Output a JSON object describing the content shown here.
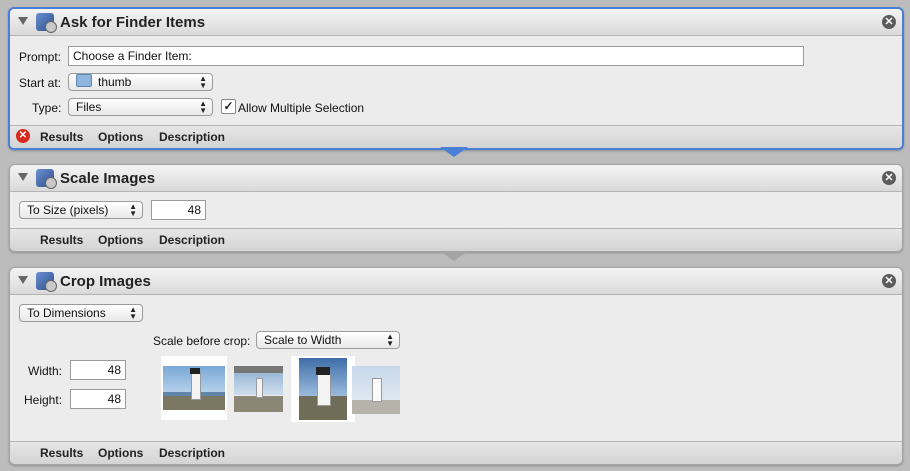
{
  "actions": {
    "ask": {
      "title": "Ask for Finder Items",
      "prompt_label": "Prompt:",
      "prompt_value": "Choose a Finder Item:",
      "start_label": "Start at:",
      "start_value": "thumb",
      "type_label": "Type:",
      "type_value": "Files",
      "allow_multiple_label": "Allow Multiple Selection",
      "allow_multiple_checked": true,
      "footer": {
        "results": "Results",
        "options": "Options",
        "description": "Description"
      }
    },
    "scale": {
      "title": "Scale Images",
      "mode_value": "To Size (pixels)",
      "size_value": "48",
      "footer": {
        "results": "Results",
        "options": "Options",
        "description": "Description"
      }
    },
    "crop": {
      "title": "Crop Images",
      "mode_value": "To Dimensions",
      "scale_before_label": "Scale before crop:",
      "scale_before_value": "Scale to Width",
      "width_label": "Width:",
      "width_value": "48",
      "height_label": "Height:",
      "height_value": "48",
      "footer": {
        "results": "Results",
        "options": "Options",
        "description": "Description"
      }
    }
  },
  "icons": {
    "disclosure": "disclosure-triangle-icon",
    "close": "close-icon",
    "error": "error-icon",
    "folder": "folder-icon"
  },
  "colors": {
    "selection_border": "#4a7fd6",
    "error_red": "#d8291f"
  }
}
